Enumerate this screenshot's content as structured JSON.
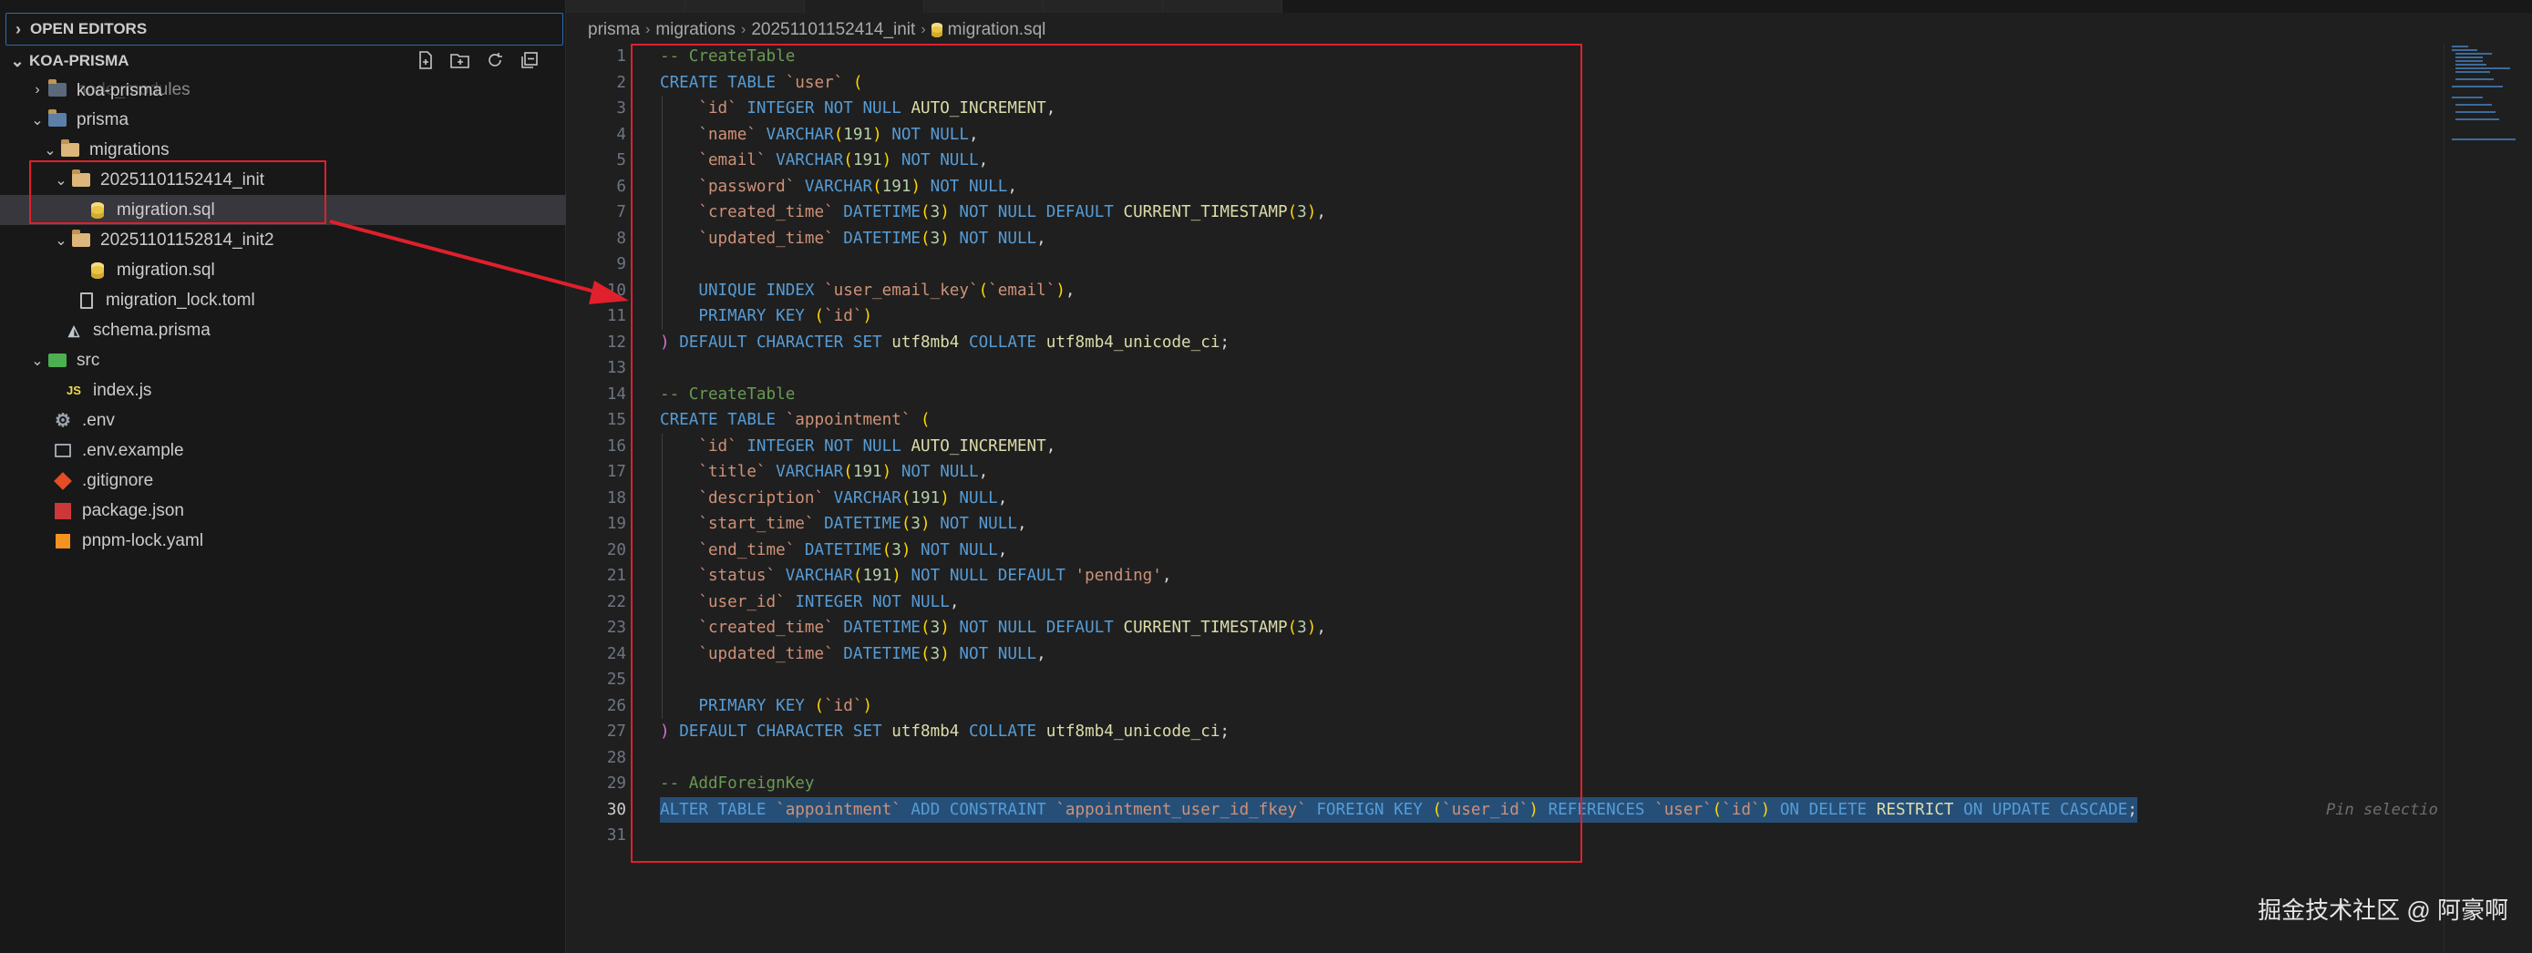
{
  "sidebar": {
    "open_editors_label": "OPEN EDITORS",
    "project_label": "KOA-PRISMA",
    "header_actions": [
      "new-file-icon",
      "new-folder-icon",
      "refresh-icon",
      "collapse-all-icon"
    ],
    "tree": [
      {
        "label": "node_modules",
        "overlay": "koa-prisma",
        "icon": "folder"
      },
      {
        "label": "prisma",
        "icon": "prisma-folder"
      },
      {
        "label": "migrations",
        "icon": "folder"
      },
      {
        "label": "20251101152414_init",
        "icon": "folder"
      },
      {
        "label": "migration.sql",
        "icon": "database"
      },
      {
        "label": "20251101152814_init2",
        "icon": "folder"
      },
      {
        "label": "migration.sql",
        "icon": "database"
      },
      {
        "label": "migration_lock.toml",
        "icon": "file"
      },
      {
        "label": "schema.prisma",
        "icon": "prisma"
      },
      {
        "label": "src",
        "icon": "folder"
      },
      {
        "label": "index.js",
        "icon": "js",
        "icon_text": "JS"
      },
      {
        "label": ".env",
        "icon": "gear"
      },
      {
        "label": ".env.example",
        "icon": "terminal"
      },
      {
        "label": ".gitignore",
        "icon": "git"
      },
      {
        "label": "package.json",
        "icon": "npm"
      },
      {
        "label": "pnpm-lock.yaml",
        "icon": "yaml"
      }
    ]
  },
  "editor": {
    "breadcrumb": [
      "prisma",
      "migrations",
      "20251101152414_init",
      "migration.sql"
    ],
    "pin_hint": "Pin selectio",
    "active_line": 30,
    "lines": [
      "-- CreateTable",
      "CREATE TABLE `user` (",
      "    `id` INTEGER NOT NULL AUTO_INCREMENT,",
      "    `name` VARCHAR(191) NOT NULL,",
      "    `email` VARCHAR(191) NOT NULL,",
      "    `password` VARCHAR(191) NOT NULL,",
      "    `created_time` DATETIME(3) NOT NULL DEFAULT CURRENT_TIMESTAMP(3),",
      "    `updated_time` DATETIME(3) NOT NULL,",
      "",
      "    UNIQUE INDEX `user_email_key`(`email`),",
      "    PRIMARY KEY (`id`)",
      ") DEFAULT CHARACTER SET utf8mb4 COLLATE utf8mb4_unicode_ci;",
      "",
      "-- CreateTable",
      "CREATE TABLE `appointment` (",
      "    `id` INTEGER NOT NULL AUTO_INCREMENT,",
      "    `title` VARCHAR(191) NOT NULL,",
      "    `description` VARCHAR(191) NULL,",
      "    `start_time` DATETIME(3) NOT NULL,",
      "    `end_time` DATETIME(3) NOT NULL,",
      "    `status` VARCHAR(191) NOT NULL DEFAULT 'pending',",
      "    `user_id` INTEGER NOT NULL,",
      "    `created_time` DATETIME(3) NOT NULL DEFAULT CURRENT_TIMESTAMP(3),",
      "    `updated_time` DATETIME(3) NOT NULL,",
      "",
      "    PRIMARY KEY (`id`)",
      ") DEFAULT CHARACTER SET utf8mb4 COLLATE utf8mb4_unicode_ci;",
      "",
      "-- AddForeignKey",
      "ALTER TABLE `appointment` ADD CONSTRAINT `appointment_user_id_fkey` FOREIGN KEY (`user_id`) REFERENCES `user`(`id`) ON DELETE RESTRICT ON UPDATE CASCADE;",
      ""
    ]
  },
  "watermark": "掘金技术社区 @ 阿豪啊",
  "colors": {
    "keyword": "#569cd6",
    "string": "#ce9178",
    "number": "#b5cea8",
    "function": "#dcdcaa",
    "comment": "#6a9955",
    "annotation_red": "#e0202c",
    "selection": "#264f78"
  }
}
